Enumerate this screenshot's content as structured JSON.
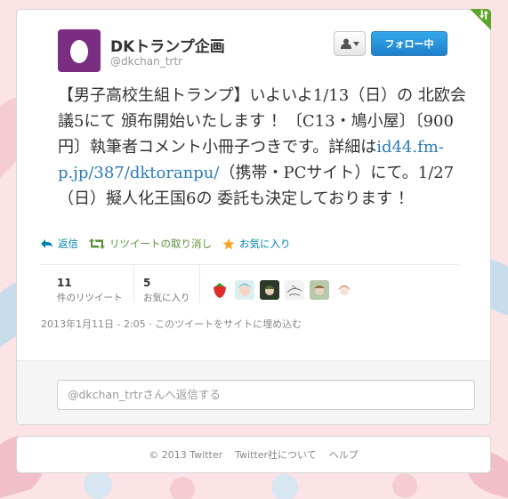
{
  "user": {
    "name": "DKトランプ企画",
    "handle": "@dkchan_trtr"
  },
  "buttons": {
    "follow_label": "フォロー中",
    "user_menu_icon": "person-icon"
  },
  "tweet": {
    "text_before_link": "【男子高校生組トランプ】いよいよ1/13（日）の 北欧会議5にて 頒布開始いたします ！〔C13・鳩小屋〕〔900円〕執筆者コメント小冊子つきです。詳細は",
    "link": "id44.fm-p.jp/387/dktoranpu/",
    "text_after_link": "（携帯・PCサイト）にて。1/27（日）擬人化王国6の 委託も決定しております ！"
  },
  "actions": {
    "reply": "返信",
    "undo_retweet": "リツイートの取り消し",
    "favorite": "お気に入り"
  },
  "stats": {
    "retweets_count": "11",
    "retweets_label": "件のリツイート",
    "favorites_count": "5",
    "favorites_label": "お気に入り"
  },
  "meta": {
    "timestamp": "2013年1月11日 - 2:05",
    "separator": "·",
    "embed_label": "このツイートをサイトに埋め込む"
  },
  "reply_box": {
    "placeholder": "@dkchan_trtrさんへ返信する"
  },
  "footer": {
    "copyright": "© 2013 Twitter",
    "about": "Twitter社について",
    "help": "ヘルプ"
  },
  "colors": {
    "link": "#0084b4",
    "follow_button": "#1f8ad6",
    "retweet_active": "#5c913b",
    "favorite_star": "#f5a623",
    "background": "#fbe3e6"
  }
}
